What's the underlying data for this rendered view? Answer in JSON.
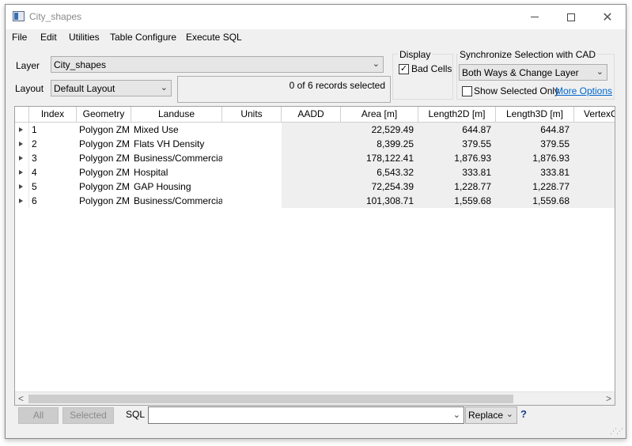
{
  "window": {
    "title": "City_shapes"
  },
  "menu": [
    "File",
    "Edit",
    "Utilities",
    "Table Configure",
    "Execute SQL"
  ],
  "layer": {
    "label": "Layer",
    "value": "City_shapes"
  },
  "layout": {
    "label": "Layout",
    "value": "Default Layout"
  },
  "records_status": "0 of 6 records selected",
  "display": {
    "title": "Display",
    "bad_cells_label": "Bad Cells",
    "bad_cells_checked": true
  },
  "sync": {
    "title": "Synchronize Selection with CAD",
    "mode": "Both Ways & Change Layer",
    "show_selected_label": "Show Selected Only",
    "show_selected_checked": false,
    "more_options": "More Options"
  },
  "table": {
    "columns": [
      "Index",
      "Geometry",
      "Landuse",
      "Units",
      "AADD",
      "Area [m]",
      "Length2D [m]",
      "Length3D [m]",
      "VertexC"
    ],
    "rows": [
      [
        "1",
        "Polygon ZM",
        "Mixed Use",
        "",
        "",
        "22,529.49",
        "644.87",
        "644.87"
      ],
      [
        "2",
        "Polygon ZM",
        "Flats VH Density",
        "",
        "",
        "8,399.25",
        "379.55",
        "379.55"
      ],
      [
        "3",
        "Polygon ZM",
        "Business/Commercial",
        "",
        "",
        "178,122.41",
        "1,876.93",
        "1,876.93"
      ],
      [
        "4",
        "Polygon ZM",
        "Hospital",
        "",
        "",
        "6,543.32",
        "333.81",
        "333.81"
      ],
      [
        "5",
        "Polygon ZM",
        "GAP Housing",
        "",
        "",
        "72,254.39",
        "1,228.77",
        "1,228.77"
      ],
      [
        "6",
        "Polygon ZM",
        "Business/Commercial",
        "",
        "",
        "101,308.71",
        "1,559.68",
        "1,559.68"
      ]
    ]
  },
  "bottom": {
    "all_label": "All",
    "selected_label": "Selected",
    "sql_label": "SQL",
    "sql_value": "",
    "replace_label": "Replace",
    "help_label": "?"
  },
  "colors": {
    "link": "#0066cc",
    "shade": "#efefef"
  },
  "icons": [
    "app-icon",
    "minimize-icon",
    "maximize-icon",
    "close-icon",
    "chevron-down-icon",
    "row-expand-icon",
    "scroll-left-icon",
    "scroll-right-icon",
    "help-icon",
    "resize-grip-icon"
  ]
}
